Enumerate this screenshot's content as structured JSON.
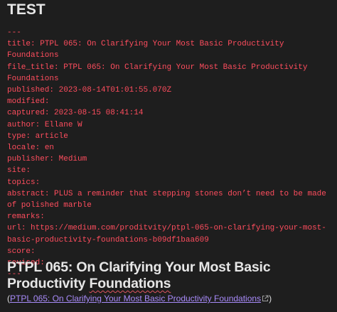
{
  "doc": {
    "title": "TEST"
  },
  "frontmatter": {
    "open": "---",
    "close": "---",
    "fields": [
      {
        "key": "title",
        "value": "PTPL 065: On Clarifying Your Most Basic Productivity Foundations"
      },
      {
        "key": "file_title",
        "value": "PTPL 065: On Clarifying Your Most Basic Productivity Foundations"
      },
      {
        "key": "published",
        "value": "2023-08-14T01:01:55.070Z"
      },
      {
        "key": "modified",
        "value": ""
      },
      {
        "key": "captured",
        "value": "2023-08-15 08:41:14"
      },
      {
        "key": "author",
        "value": "Ellane W"
      },
      {
        "key": "type",
        "value": "article"
      },
      {
        "key": "locale",
        "value": "en"
      },
      {
        "key": "publisher",
        "value": "Medium"
      },
      {
        "key": "site",
        "value": ""
      },
      {
        "key": "topics",
        "value": ""
      },
      {
        "key": "abstract",
        "value": "PLUS a reminder that stepping stones don’t need to be made of polished marble"
      },
      {
        "key": "remarks",
        "value": ""
      },
      {
        "key": "url",
        "value": "https://medium.com/proditvity/ptpl-065-on-clarifying-your-most-basic-productivity-foundations-b09df1baa609"
      },
      {
        "key": "score",
        "value": ""
      },
      {
        "key": "revised",
        "value": ""
      }
    ]
  },
  "article": {
    "heading_prefix": "PTPL 065: On Clarifying Your Most Basic Productivity",
    "heading_suffix": "Foundations",
    "source_open": "(",
    "source_link": "PTPL 065: On Clarifying Your Most Basic Productivity Foundations",
    "source_close": ")",
    "link_color": "#a88bfa",
    "frontmatter_color": "#ff4d5e",
    "link_icon": "external-link-icon"
  }
}
